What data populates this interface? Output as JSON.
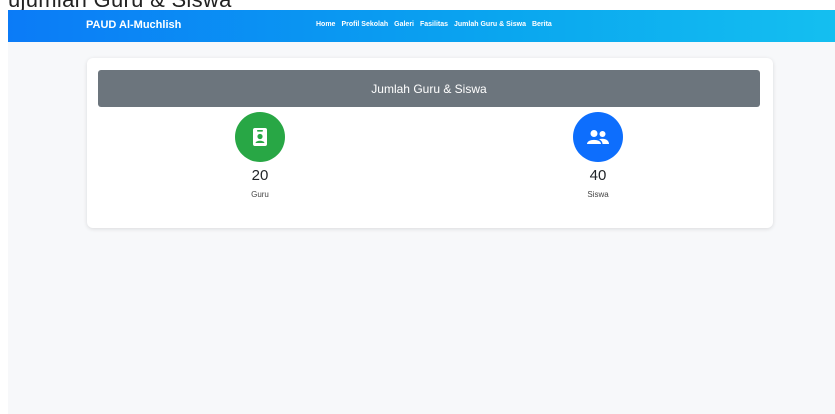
{
  "top_strip_text": "ujumlah Guru & Siswa",
  "navbar": {
    "brand": "PAUD Al-Muchlish",
    "links": [
      "Home",
      "Profil Sekolah",
      "Galeri",
      "Fasilitas",
      "Jumlah Guru & Siswa",
      "Berita"
    ]
  },
  "card": {
    "title": "Jumlah Guru & Siswa",
    "stats": [
      {
        "value": "20",
        "label": "Guru",
        "icon": "id-badge-icon",
        "color": "#28a745"
      },
      {
        "value": "40",
        "label": "Siswa",
        "icon": "users-icon",
        "color": "#0d6efd"
      }
    ]
  },
  "colors": {
    "navbar_start": "#0b7bf7",
    "navbar_end": "#14bff0",
    "card_header": "#6c757d",
    "page_background": "#f7f8fa"
  }
}
